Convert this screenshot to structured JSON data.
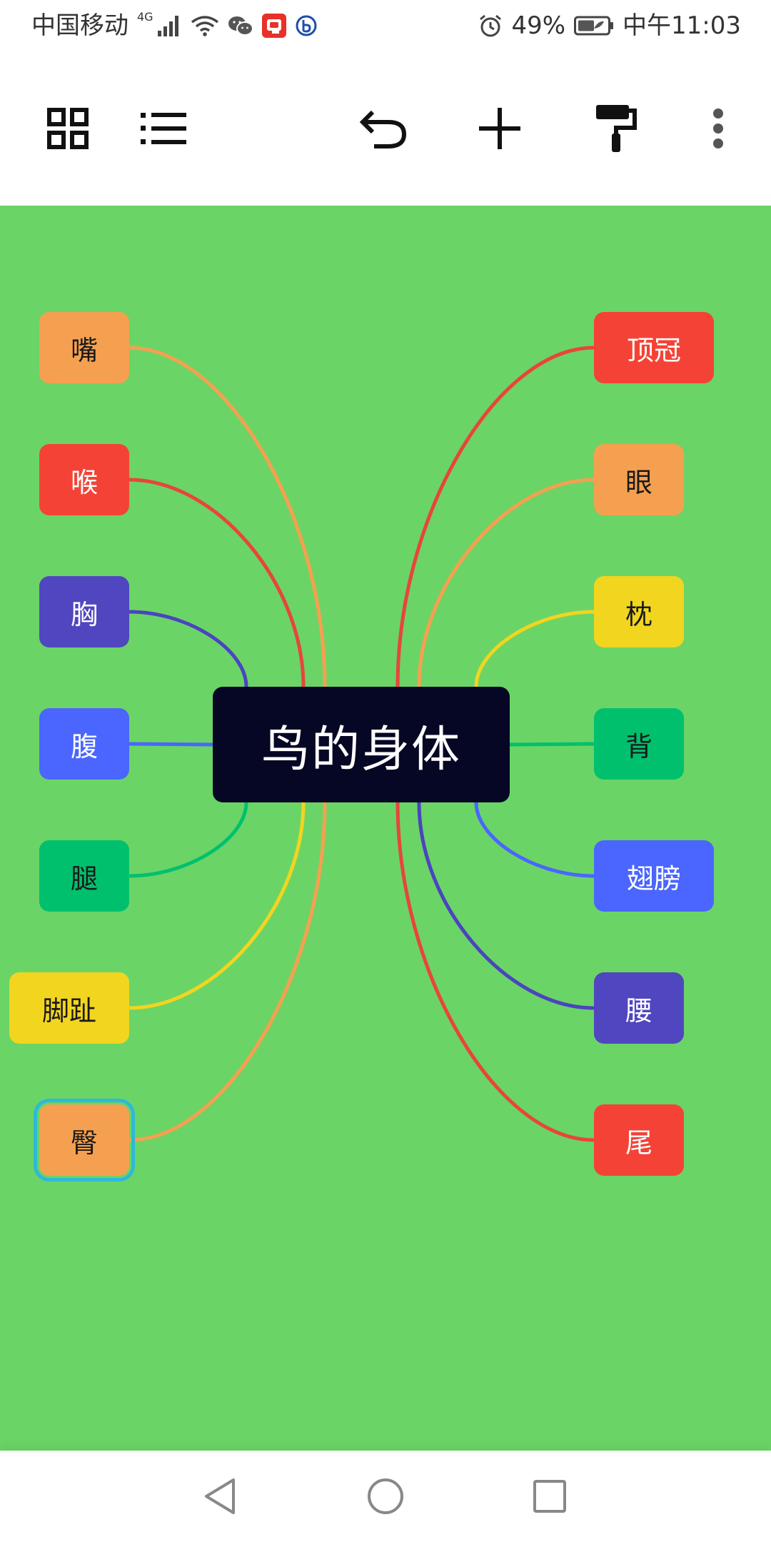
{
  "status_bar": {
    "carrier": "中国移动",
    "network_type": "4G",
    "battery_percent": "49%",
    "time": "中午11:03",
    "icons": [
      "signal-icon",
      "wifi-icon",
      "wechat-icon",
      "app-notification-icon",
      "app-notification-icon-2",
      "alarm-icon",
      "battery-icon"
    ]
  },
  "toolbar": {
    "icons": [
      "grid-view-icon",
      "outline-list-icon",
      "undo-icon",
      "add-icon",
      "format-paint-icon",
      "more-options-icon"
    ]
  },
  "mindmap": {
    "root": {
      "label": "鸟的身体",
      "color": "#050725"
    },
    "left_nodes": [
      {
        "label": "嘴",
        "color": "#f5a050",
        "text_color": "#1a1a1a",
        "line_color": "#f5a050",
        "selected": false
      },
      {
        "label": "喉",
        "color": "#f44336",
        "text_color": "#ffffff",
        "line_color": "#e8453a",
        "selected": false
      },
      {
        "label": "胸",
        "color": "#5046c0",
        "text_color": "#ffffff",
        "line_color": "#4a44c0",
        "selected": false
      },
      {
        "label": "腹",
        "color": "#4a66ff",
        "text_color": "#ffffff",
        "line_color": "#4a66ff",
        "selected": false
      },
      {
        "label": "腿",
        "color": "#00c06e",
        "text_color": "#1a1a1a",
        "line_color": "#00c06e",
        "selected": false
      },
      {
        "label": "脚趾",
        "color": "#f2d51f",
        "text_color": "#1a1a1a",
        "line_color": "#f2d51f",
        "selected": false
      },
      {
        "label": "臀",
        "color": "#f5a050",
        "text_color": "#1a1a1a",
        "line_color": "#f5a050",
        "selected": true
      }
    ],
    "right_nodes": [
      {
        "label": "顶冠",
        "color": "#f44336",
        "text_color": "#ffffff",
        "line_color": "#e8453a"
      },
      {
        "label": "眼",
        "color": "#f5a050",
        "text_color": "#1a1a1a",
        "line_color": "#f5a050"
      },
      {
        "label": "枕",
        "color": "#f2d51f",
        "text_color": "#1a1a1a",
        "line_color": "#f2d51f"
      },
      {
        "label": "背",
        "color": "#00c06e",
        "text_color": "#1a1a1a",
        "line_color": "#00c06e"
      },
      {
        "label": "翅膀",
        "color": "#4a66ff",
        "text_color": "#ffffff",
        "line_color": "#4a66ff"
      },
      {
        "label": "腰",
        "color": "#5046c0",
        "text_color": "#ffffff",
        "line_color": "#4a44c0"
      },
      {
        "label": "尾",
        "color": "#f44336",
        "text_color": "#ffffff",
        "line_color": "#e8453a"
      }
    ]
  },
  "nav_bar": {
    "icons": [
      "back-icon",
      "home-icon",
      "recents-icon"
    ]
  },
  "colors": {
    "canvas_background": "#6bd466",
    "selection_outline": "#2fb8d8"
  }
}
